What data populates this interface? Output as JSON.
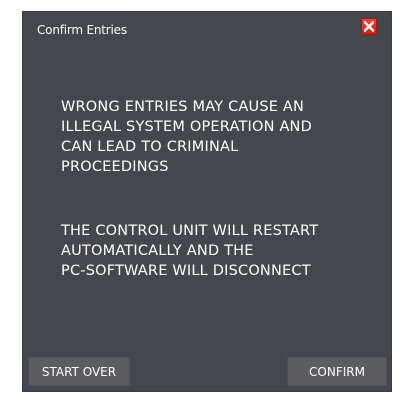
{
  "dialog": {
    "title": "Confirm Entries",
    "close_icon": "close-icon",
    "message_1": "WRONG ENTRIES MAY CAUSE AN\nILLEGAL SYSTEM OPERATION AND\nCAN LEAD TO CRIMINAL\nPROCEEDINGS",
    "message_2": "THE CONTROL UNIT WILL RESTART\nAUTOMATICALLY AND THE\nPC-SOFTWARE WILL DISCONNECT",
    "start_over_label": "START OVER",
    "confirm_label": "CONFIRM"
  },
  "colors": {
    "dialog_background": "#45474e",
    "button_background": "#5b5d63",
    "close_button": "#e0352a",
    "text": "#ffffff"
  }
}
